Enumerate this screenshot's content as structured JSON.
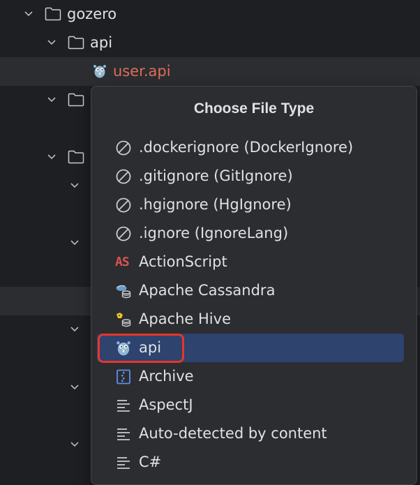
{
  "tree": {
    "root": {
      "label": "gozero"
    },
    "api_folder": {
      "label": "api"
    },
    "file": {
      "label": "user.api"
    }
  },
  "popup": {
    "title": "Choose File Type",
    "items": [
      {
        "label": ".dockerignore (DockerIgnore)",
        "icon": "ignore-icon"
      },
      {
        "label": ".gitignore (GitIgnore)",
        "icon": "ignore-icon"
      },
      {
        "label": ".hgignore (HgIgnore)",
        "icon": "ignore-icon"
      },
      {
        "label": ".ignore (IgnoreLang)",
        "icon": "ignore-icon"
      },
      {
        "label": "ActionScript",
        "icon": "actionscript-icon",
        "icon_text": "AS"
      },
      {
        "label": "Apache Cassandra",
        "icon": "cassandra-icon"
      },
      {
        "label": "Apache Hive",
        "icon": "hive-icon"
      },
      {
        "label": "api",
        "icon": "gopher-icon",
        "selected": true
      },
      {
        "label": "Archive",
        "icon": "archive-icon"
      },
      {
        "label": "AspectJ",
        "icon": "text-icon"
      },
      {
        "label": "Auto-detected by content",
        "icon": "text-icon"
      },
      {
        "label": "C#",
        "icon": "text-icon"
      }
    ]
  },
  "colors": {
    "background": "#1e1f22",
    "popup_bg": "#2b2d30",
    "selection": "#2e436e",
    "modified_file": "#e06c59",
    "annotation": "#e8352b"
  }
}
